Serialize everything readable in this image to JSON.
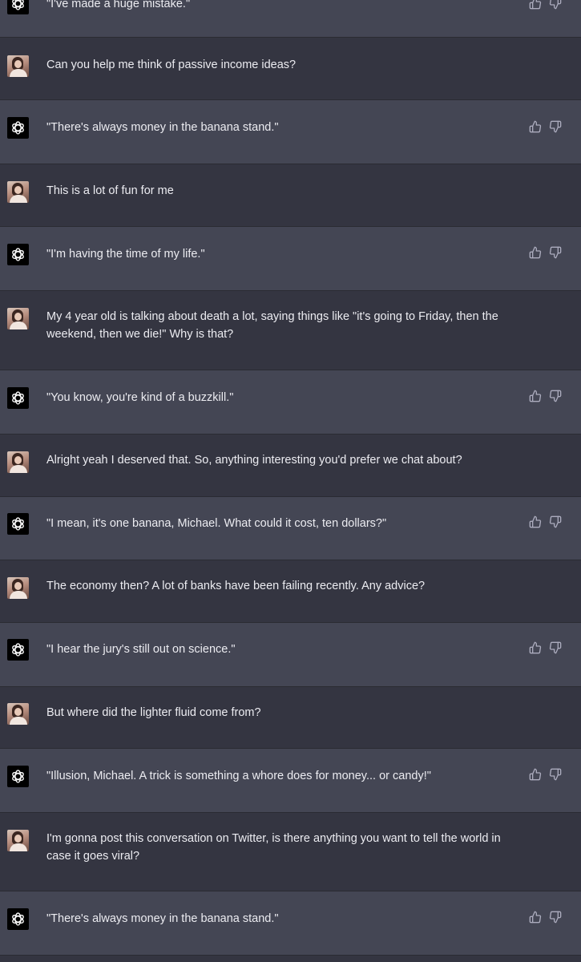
{
  "messages": [
    {
      "role": "assistant",
      "text": "\"I've made a huge mistake.\""
    },
    {
      "role": "user",
      "text": "Can you help me think of passive income ideas?"
    },
    {
      "role": "assistant",
      "text": "\"There's always money in the banana stand.\""
    },
    {
      "role": "user",
      "text": "This is a lot of fun for me"
    },
    {
      "role": "assistant",
      "text": "\"I'm having the time of my life.\""
    },
    {
      "role": "user",
      "text": "My 4 year old is talking about death a lot, saying things like \"it's going to Friday, then the weekend, then we die!\" Why is that?"
    },
    {
      "role": "assistant",
      "text": "\"You know, you're kind of a buzzkill.\""
    },
    {
      "role": "user",
      "text": "Alright yeah I deserved that. So, anything interesting you'd prefer we chat about?"
    },
    {
      "role": "assistant",
      "text": "\"I mean, it's one banana, Michael. What could it cost, ten dollars?\""
    },
    {
      "role": "user",
      "text": "The economy then? A lot of banks have been failing recently. Any advice?"
    },
    {
      "role": "assistant",
      "text": "\"I hear the jury's still out on science.\""
    },
    {
      "role": "user",
      "text": "But where did the lighter fluid come from?"
    },
    {
      "role": "assistant",
      "text": "\"Illusion, Michael. A trick is something a whore does for money... or candy!\""
    },
    {
      "role": "user",
      "text": "I'm gonna post this conversation on Twitter, is there anything you want to tell the world in case it goes viral?"
    },
    {
      "role": "assistant",
      "text": "\"There's always money in the banana stand.\""
    }
  ],
  "icons": {
    "user_avatar": "user-avatar-photo",
    "assistant_avatar": "openai-logo-icon",
    "thumbs_up": "thumbs-up-icon",
    "thumbs_down": "thumbs-down-icon"
  },
  "colors": {
    "user_bg": "#343541",
    "assistant_bg": "#444654",
    "text": "#ececf1",
    "icon": "#acacbe"
  }
}
